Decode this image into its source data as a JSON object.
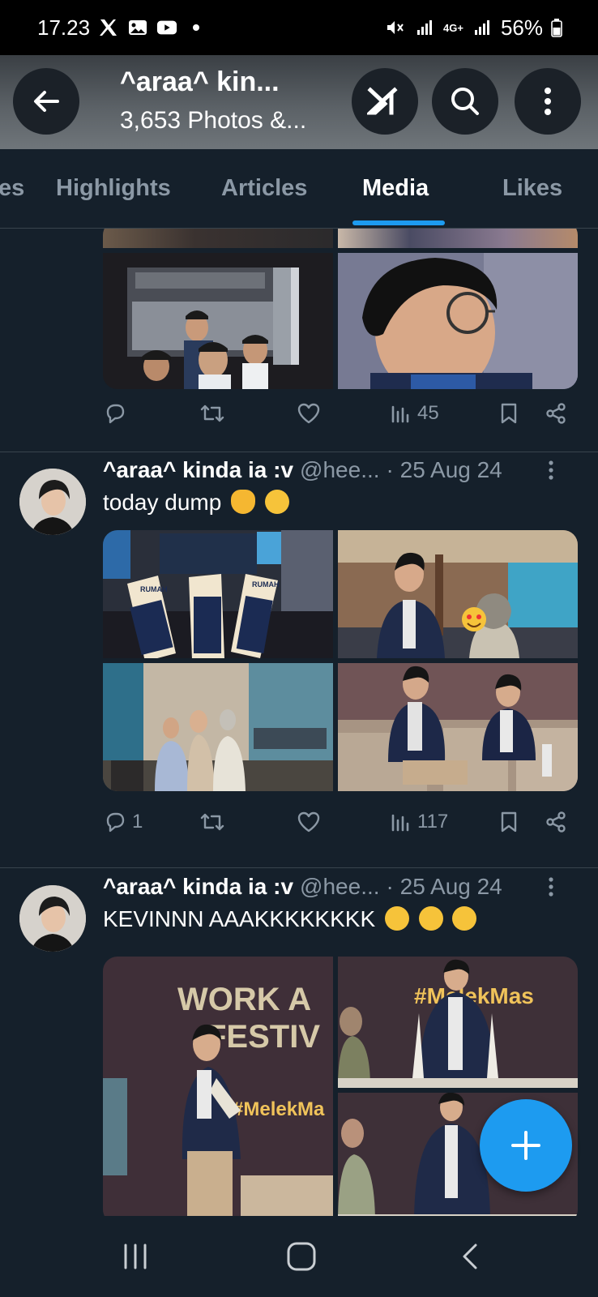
{
  "status_bar": {
    "time": "17.23",
    "battery": "56%",
    "network": "4G+"
  },
  "header": {
    "title": "^araa^ kin...",
    "subtitle": "3,653 Photos &..."
  },
  "tabs": [
    {
      "label": "es",
      "active": false
    },
    {
      "label": "Highlights",
      "active": false
    },
    {
      "label": "Articles",
      "active": false
    },
    {
      "label": "Media",
      "active": true
    },
    {
      "label": "Likes",
      "active": false
    }
  ],
  "posts": [
    {
      "partial": true,
      "stats": {
        "replies": "",
        "views": "45"
      }
    },
    {
      "name": "^araa^ kinda ia :v",
      "handle": "@hee...",
      "date": "· 25 Aug 24",
      "text": "today dump",
      "stats": {
        "replies": "1",
        "views": "117"
      },
      "photo_text": {
        "poster": "RUMAH"
      }
    },
    {
      "name": "^araa^ kinda ia :v",
      "handle": "@hee...",
      "date": "· 25 Aug 24",
      "text": "KEVINNN AAAKKKKKKKK",
      "photo_text": {
        "banner_line1": "WORK A",
        "banner_line2": "FESTIV",
        "hashtag_left": "#MelekMa",
        "hashtag_top": "#MelekMas"
      }
    }
  ],
  "colors": {
    "background": "#15202b",
    "accent": "#1d9bf0",
    "muted": "#8b98a5",
    "divider": "#38444d"
  }
}
